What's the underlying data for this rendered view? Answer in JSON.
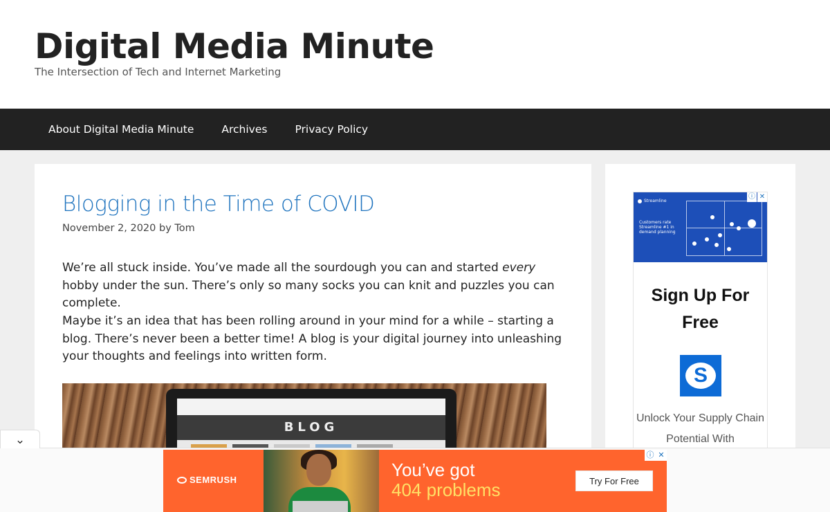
{
  "header": {
    "site_title": "Digital Media Minute",
    "tagline": "The Intersection of Tech and Internet Marketing"
  },
  "nav": {
    "items": [
      {
        "label": "About Digital Media Minute"
      },
      {
        "label": "Archives"
      },
      {
        "label": "Privacy Policy"
      }
    ]
  },
  "post": {
    "title": "Blogging in the Time of COVID",
    "meta": "November 2, 2020 by Tom",
    "p1_before": "We’re all stuck inside. You’ve made all the sourdough you can and started ",
    "p1_em": "every",
    "p1_after": " hobby under the sun. There’s only so many socks you can knit and puzzles you can complete.",
    "p2": "Maybe it’s an idea that has been rolling around in your mind for a while – starting a blog. There’s never been a better time! A blog is your digital journey into unleashing your thoughts and feelings into written form.",
    "image_banner_text": "BLOG"
  },
  "sidebar_ad": {
    "brand": "Streamline",
    "small_text": "Customers rate Streamline #1 in demand planning",
    "headline": "Sign Up For Free",
    "logo_letter": "S",
    "body": "Unlock Your Supply Chain Potential With"
  },
  "ad_choices": {
    "info_icon": "ⓘ",
    "close_icon": "✕"
  },
  "collapse_toggle": "⌄",
  "bottom_ad": {
    "brand": "SEMRUSH",
    "line1": "You’ve got",
    "line2": "404 problems",
    "cta": "Try For Free"
  },
  "colors": {
    "nav_bg": "#222222",
    "link_blue": "#1e73be",
    "semrush_orange": "#ff642d",
    "streamline_blue": "#1d4fb8"
  }
}
